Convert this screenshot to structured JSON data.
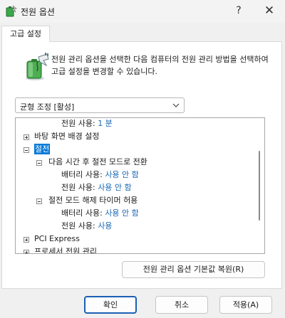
{
  "window": {
    "title": "전원 옵션",
    "help_glyph": "?",
    "close_glyph": "✕"
  },
  "tab": {
    "label": "고급 설정"
  },
  "description": "전원 관리 옵션을 선택한 다음 컴퓨터의 전원 관리 방법을 선택하여 고급 설정을 변경할 수 있습니다.",
  "plan_dropdown": {
    "selected": "균형 조정 [활성]"
  },
  "tree": {
    "rows": [
      {
        "label": "전원 사용:",
        "value": "1 분"
      },
      {
        "label": "바탕 화면 배경 설정",
        "expander": "+"
      },
      {
        "label": "절전",
        "expander": "-",
        "selected": true
      },
      {
        "label": "다음 시간 후 절전 모드로 전환",
        "expander": "-"
      },
      {
        "label": "배터리 사용:",
        "value": "사용 안 함"
      },
      {
        "label": "전원 사용:",
        "value": "사용 안 함"
      },
      {
        "label": "절전 모드 해제 타이머 허용",
        "expander": "-"
      },
      {
        "label": "배터리 사용:",
        "value": "사용 안 함"
      },
      {
        "label": "전원 사용:",
        "value": "사용"
      },
      {
        "label": "PCI Express",
        "expander": "+"
      },
      {
        "label": "프로세서 전원 관리",
        "expander": "+"
      }
    ]
  },
  "restore_button": {
    "label": "전원 관리 옵션 기본값 복원(R)"
  },
  "buttons": {
    "ok": "확인",
    "cancel": "취소",
    "apply": "적용(A)"
  },
  "colors": {
    "accent": "#0078d7",
    "value_text": "#1a67b4",
    "default_button_border": "#1b5fb4"
  },
  "icons": {
    "app": "power-options-icon",
    "description": "battery-plug-icon"
  }
}
